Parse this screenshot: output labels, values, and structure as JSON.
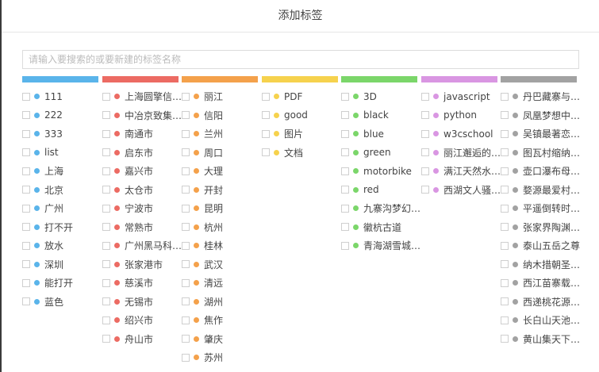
{
  "dialog": {
    "title": "添加标签"
  },
  "search": {
    "placeholder": "请输入要搜索的或要新建的标签名称",
    "value": ""
  },
  "groups": [
    {
      "color": "#5ab4ea",
      "tags": [
        "111",
        "222",
        "333",
        "list",
        "上海",
        "北京",
        "广州",
        "打不开",
        "放水",
        "深圳",
        "能打开",
        "蓝色"
      ]
    },
    {
      "color": "#ec6b63",
      "tags": [
        "上海圆擎信…",
        "中冶京致集…",
        "南通市",
        "启东市",
        "嘉兴市",
        "太仓市",
        "宁波市",
        "常熟市",
        "广州黑马科…",
        "张家港市",
        "慈溪市",
        "无锡市",
        "绍兴市",
        "舟山市"
      ]
    },
    {
      "color": "#f4a14b",
      "tags": [
        "丽江",
        "信阳",
        "兰州",
        "周口",
        "大理",
        "开封",
        "昆明",
        "杭州",
        "桂林",
        "武汉",
        "清远",
        "湖州",
        "焦作",
        "肇庆",
        "苏州"
      ]
    },
    {
      "color": "#f6d24d",
      "tags": [
        "PDF",
        "good",
        "图片",
        "文档"
      ]
    },
    {
      "color": "#7bd66a",
      "tags": [
        "3D",
        "black",
        "blue",
        "green",
        "motorbike",
        "red",
        "九寨沟梦幻…",
        "徽杭古道",
        "青海湖雪城…"
      ]
    },
    {
      "color": "#d996e2",
      "tags": [
        "javascript",
        "python",
        "w3cschool",
        "丽江邂逅的…",
        "满江天然水…",
        "西湖文人骚…"
      ]
    },
    {
      "color": "#a2a2a2",
      "tags": [
        "丹巴藏寨与…",
        "凤凰梦想中…",
        "吴镇最著恋…",
        "图瓦村缩纳…",
        "壶口瀑布母…",
        "婺源最爱村…",
        "平遥倒转时…",
        "张家界陶渊…",
        "泰山五岳之尊",
        "纳木措朝圣…",
        "西江苗寨载…",
        "西递桃花源…",
        "长白山天池…",
        "黄山集天下…"
      ]
    }
  ]
}
